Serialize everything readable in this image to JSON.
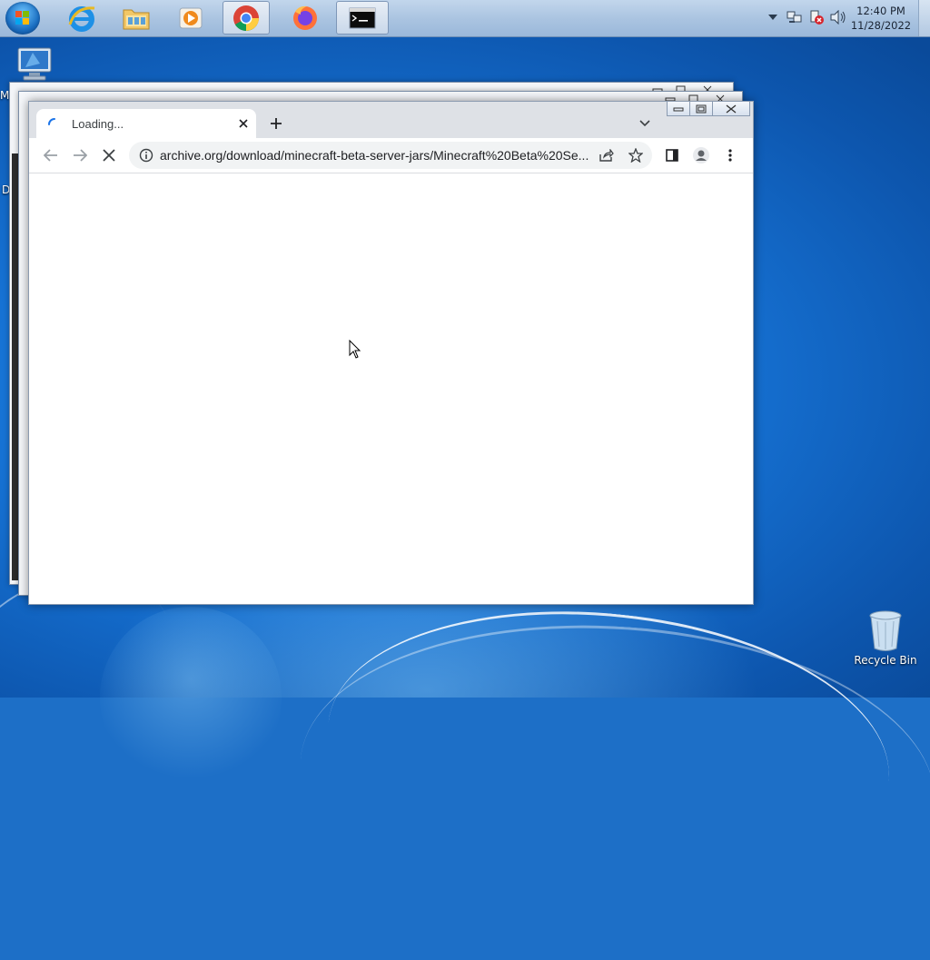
{
  "taskbar": {
    "pinned": [
      "windows-orb",
      "internet-explorer",
      "windows-explorer",
      "media-player",
      "chrome",
      "firefox",
      "command-prompt"
    ],
    "clock": {
      "time": "12:40 PM",
      "date": "11/28/2022"
    }
  },
  "desktop": {
    "icons": [
      {
        "name": "computer-icon",
        "label": "M"
      },
      {
        "name": "recycle-bin-icon",
        "label": "Recycle Bin"
      }
    ],
    "partial_label": "D"
  },
  "browser": {
    "tab_title": "Loading...",
    "url": "archive.org/download/minecraft-beta-server-jars/Minecraft%20Beta%20Se..."
  },
  "colors": {
    "accent": "#1a73e8",
    "tabstrip": "#dee1e6"
  }
}
